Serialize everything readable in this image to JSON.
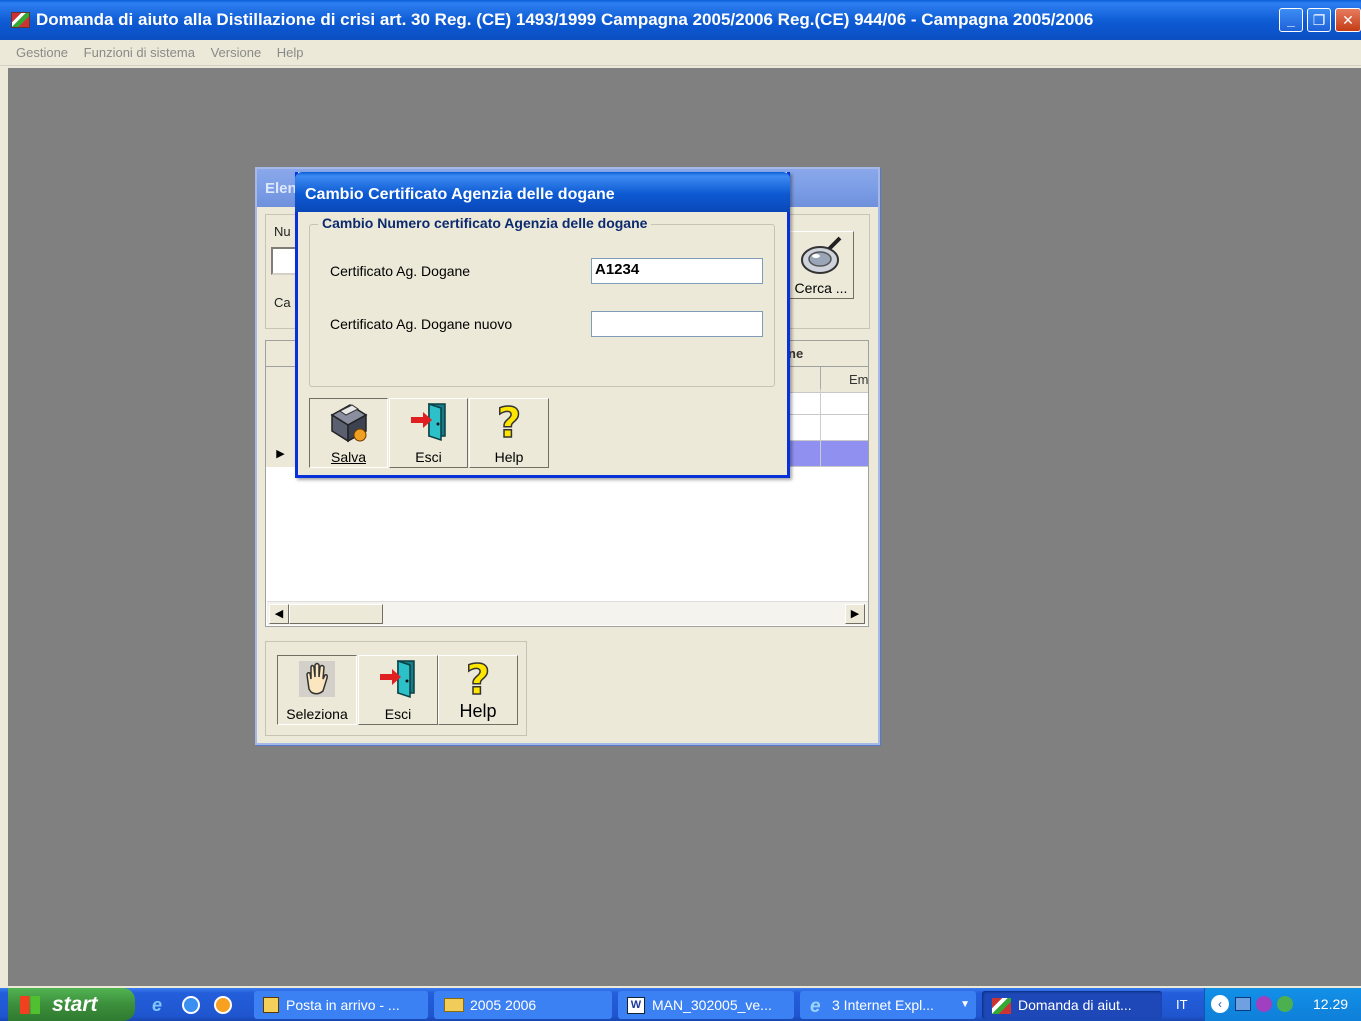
{
  "app": {
    "title": "Domanda di aiuto alla Distillazione di crisi art. 30 Reg. (CE) 1493/1999 Campagna 2005/2006 Reg.(CE) 944/06 - Campagna 2005/2006",
    "menu": [
      "Gestione",
      "Funzioni di sistema",
      "Versione",
      "Help"
    ]
  },
  "list_window": {
    "title_visible": "Elen",
    "label_num_visible": "Nu",
    "label_car_visible": "Ca",
    "search_button": "Cerca ...",
    "grid_header_partial": "ne",
    "grid_col_partial": "Em",
    "buttons": {
      "select": "Seleziona",
      "exit": "Esci",
      "help": "Help"
    }
  },
  "dialog": {
    "title": "Cambio Certificato Agenzia delle dogane",
    "group_title": "Cambio Numero certificato Agenzia delle dogane",
    "field_current_label": "Certificato Ag. Dogane",
    "field_current_value": "A1234",
    "field_new_label": "Certificato Ag. Dogane nuovo",
    "field_new_value": "",
    "buttons": {
      "save": "Salva",
      "exit": "Esci",
      "help": "Help"
    }
  },
  "taskbar": {
    "start": "start",
    "tasks": [
      "Posta in arrivo - ...",
      "2005 2006",
      "MAN_302005_ve...",
      "3 Internet Expl...",
      "Domanda di aiut..."
    ],
    "language": "IT",
    "clock": "12.29"
  },
  "colors": {
    "title_blue": "#0b56d0",
    "desktop_grey": "#808080",
    "window_face": "#ece9d8",
    "selected_row": "#9090f0",
    "taskbar_blue": "#245edb",
    "start_green": "#3c8f3c"
  }
}
